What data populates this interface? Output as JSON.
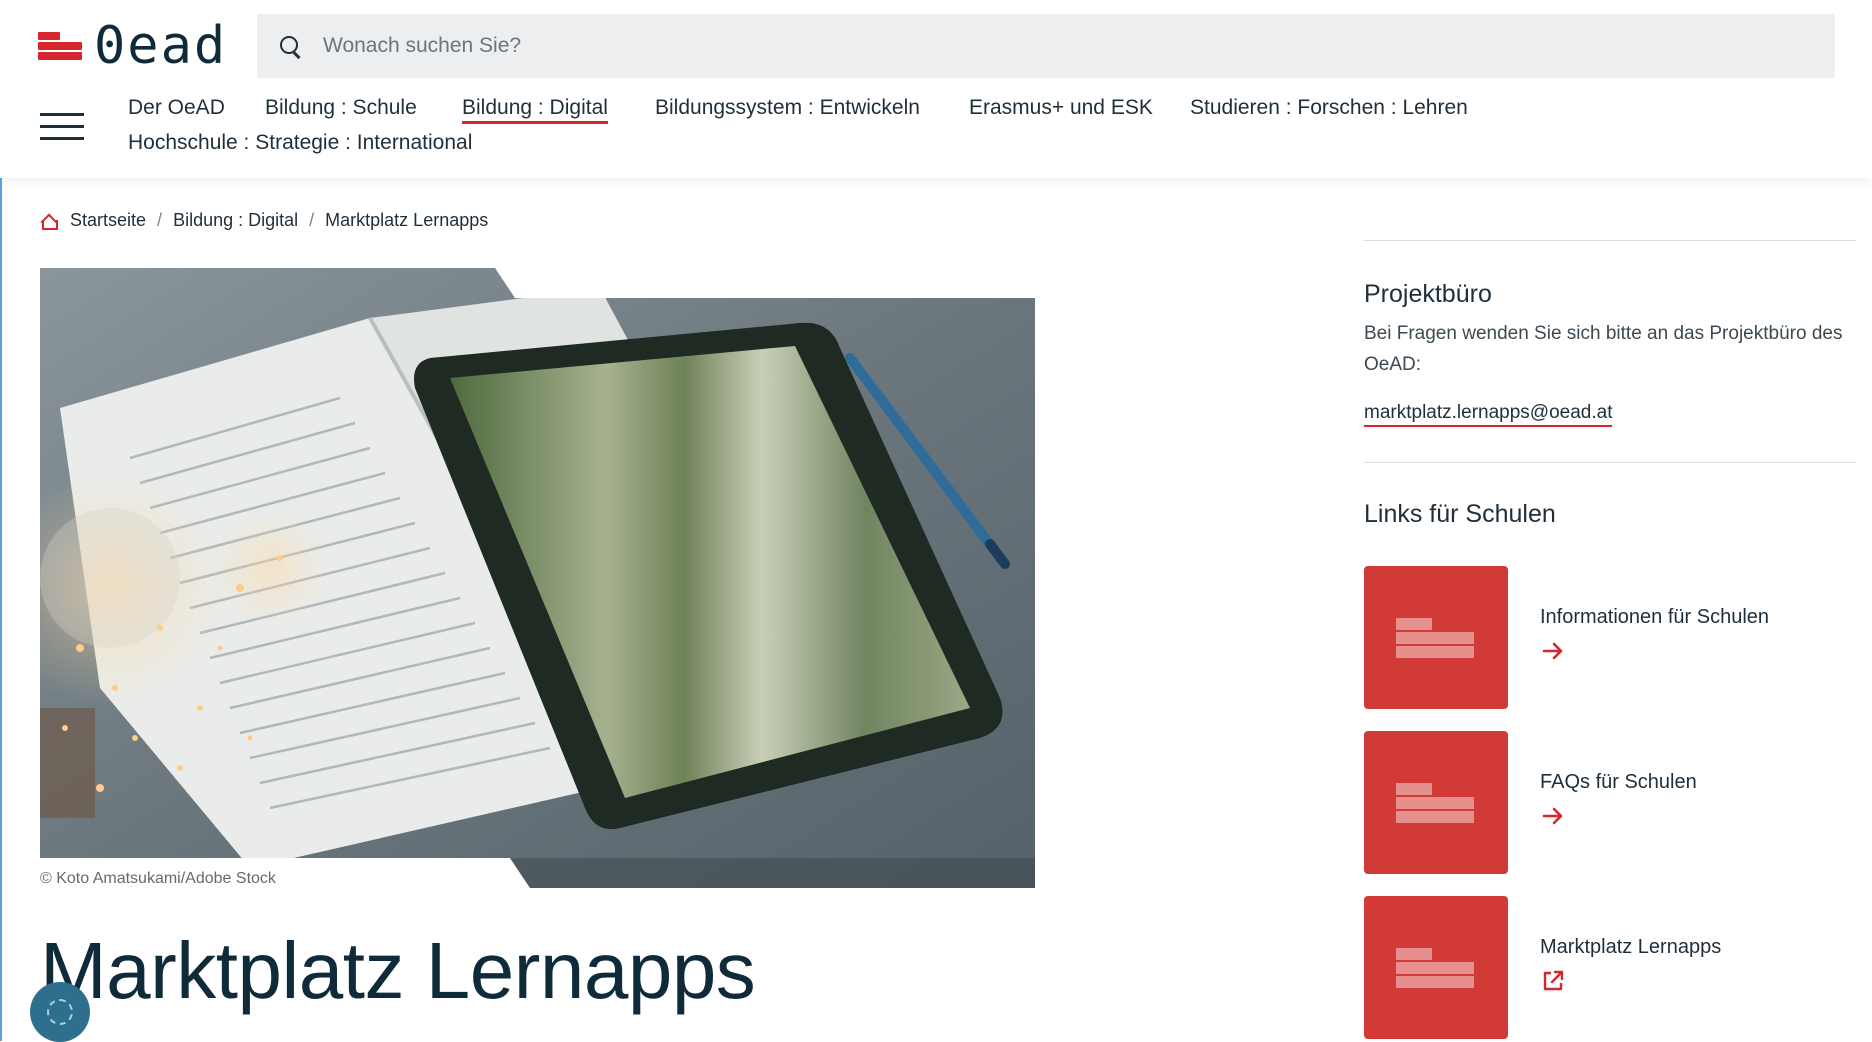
{
  "header": {
    "logo_text": "0ead",
    "search_placeholder": "Wonach suchen Sie?",
    "nav": [
      {
        "label": "Der OeAD",
        "active": false
      },
      {
        "label": "Bildung : Schule",
        "active": false
      },
      {
        "label": "Bildung : Digital",
        "active": true
      },
      {
        "label": "Bildungssystem : Entwickeln",
        "active": false
      },
      {
        "label": "Erasmus+ und ESK",
        "active": false
      },
      {
        "label": "Studieren : Forschen : Lehren",
        "active": false
      },
      {
        "label": "Hochschule : Strategie : International",
        "active": false
      }
    ]
  },
  "breadcrumb": [
    "Startseite",
    "Bildung : Digital",
    "Marktplatz Lernapps"
  ],
  "hero": {
    "caption": "© Koto Amatsukami/Adobe Stock"
  },
  "page_title": "Marktplatz Lernapps",
  "sidebar": {
    "projektbuero": {
      "title": "Projektbüro",
      "text": "Bei Fragen wenden Sie sich bitte an das Projektbüro des OeAD:",
      "email": "marktplatz.lernapps@oead.at"
    },
    "links_title": "Links für Schulen",
    "links": [
      {
        "label": "Informationen für Schulen",
        "icon": "arrow-right-icon"
      },
      {
        "label": "FAQs für Schulen",
        "icon": "arrow-right-icon"
      },
      {
        "label": "Marktplatz Lernapps",
        "icon": "external-link-icon"
      }
    ]
  },
  "colors": {
    "brand_red": "#d4262c",
    "tile_red": "#d13a37",
    "text_dark": "#0f2b3a",
    "search_bg": "#eceeef"
  }
}
